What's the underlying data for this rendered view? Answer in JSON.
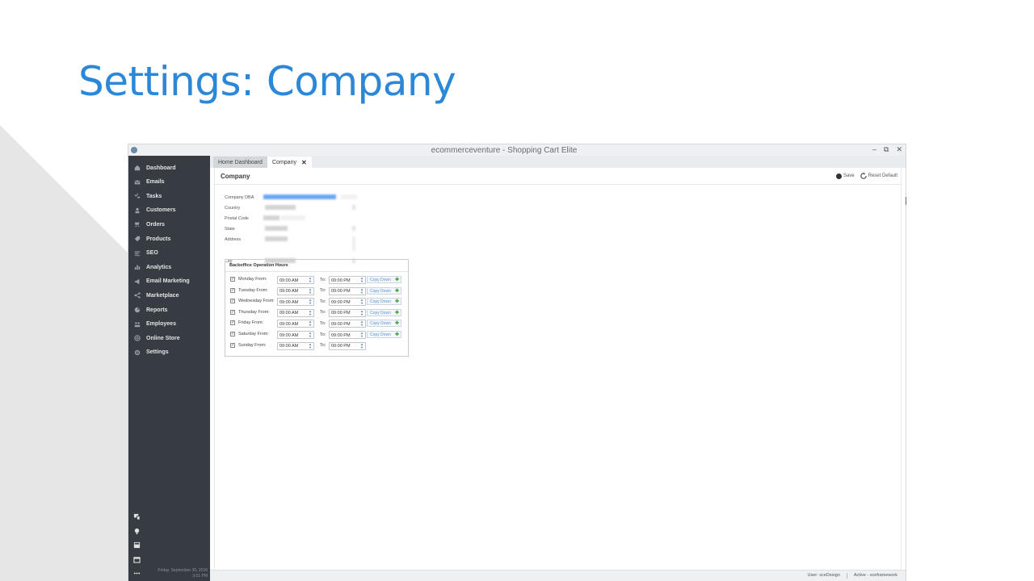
{
  "slide": {
    "title": "Settings: Company"
  },
  "window": {
    "title": "ecommerceventure - Shopping Cart Elite",
    "controls": [
      "–",
      "⧉",
      "✕"
    ]
  },
  "sidebar": {
    "items": [
      {
        "label": "Dashboard",
        "icon": "home-icon"
      },
      {
        "label": "Emails",
        "icon": "mail-icon"
      },
      {
        "label": "Tasks",
        "icon": "tasks-icon"
      },
      {
        "label": "Customers",
        "icon": "user-icon"
      },
      {
        "label": "Orders",
        "icon": "cart-icon"
      },
      {
        "label": "Products",
        "icon": "tag-icon"
      },
      {
        "label": "SEO",
        "icon": "seo-icon"
      },
      {
        "label": "Analytics",
        "icon": "bar-chart-icon"
      },
      {
        "label": "Email Marketing",
        "icon": "megaphone-icon"
      },
      {
        "label": "Marketplace",
        "icon": "share-icon"
      },
      {
        "label": "Reports",
        "icon": "pie-icon"
      },
      {
        "label": "Employees",
        "icon": "employees-icon"
      },
      {
        "label": "Online Store",
        "icon": "globe-icon"
      },
      {
        "label": "Settings",
        "icon": "gear-icon"
      }
    ],
    "tools": [
      "devices-icon",
      "lightbulb-icon",
      "calculator-icon",
      "calendar-icon",
      "more-icon"
    ],
    "date": "Friday, September 30, 2016",
    "time": "3:01 PM"
  },
  "tabs": [
    {
      "label": "Home Dashboard"
    },
    {
      "label": "Company",
      "close": "✕"
    }
  ],
  "page": {
    "title": "Company",
    "save_label": "Save",
    "reset_label": "Reset Default"
  },
  "form": {
    "labels": {
      "company_dba": "Company DBA",
      "country": "Country",
      "postal_code": "Postal Code",
      "state": "State",
      "address": "Address",
      "city": "City"
    }
  },
  "hours": {
    "title": "Backoffice Operation Hours",
    "to_label": "To:",
    "copy_label": "Copy Down",
    "rows": [
      {
        "day": "Monday From:",
        "from": "09:00 AM",
        "to": "09:00 PM",
        "checked": "✓",
        "copy": true
      },
      {
        "day": "Tuesday From:",
        "from": "09:00 AM",
        "to": "09:00 PM",
        "checked": "✓",
        "copy": true
      },
      {
        "day": "Wednesday From:",
        "from": "09:00 AM",
        "to": "09:00 PM",
        "checked": "✓",
        "copy": true
      },
      {
        "day": "Thursday From:",
        "from": "09:00 AM",
        "to": "09:00 PM",
        "checked": "✓",
        "copy": true
      },
      {
        "day": "Friday From:",
        "from": "09:00 AM",
        "to": "09:00 PM",
        "checked": "✓",
        "copy": true
      },
      {
        "day": "Saturday From:",
        "from": "09:00 AM",
        "to": "09:00 PM",
        "checked": "✓",
        "copy": true
      },
      {
        "day": "Sunday From:",
        "from": "09:00 AM",
        "to": "09:00 PM",
        "checked": "✓",
        "copy": false
      }
    ]
  },
  "status": {
    "user": "User: sceDesign",
    "active": "Active - sceframework"
  },
  "colors": {
    "title_blue": "#2b88d8",
    "sidebar_bg": "#373c42",
    "copy_plus_green": "#3c9a3c"
  }
}
